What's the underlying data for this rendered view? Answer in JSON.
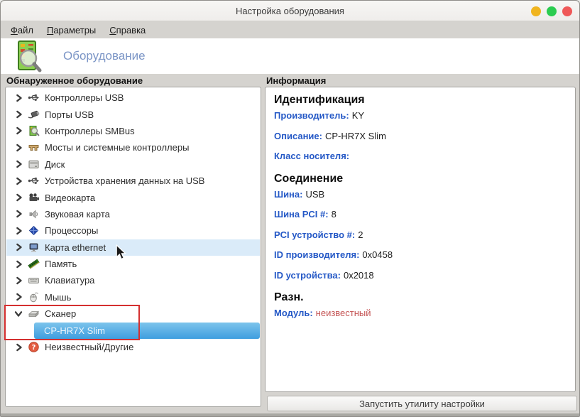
{
  "window": {
    "title": "Настройка оборудования"
  },
  "titlebar_buttons": [
    {
      "name": "minimize-button",
      "color": "#f0b41e"
    },
    {
      "name": "maximize-button",
      "color": "#2bcc50"
    },
    {
      "name": "close-button",
      "color": "#ef5858"
    }
  ],
  "menu": {
    "items": [
      {
        "label": "Файл"
      },
      {
        "label": "Параметры"
      },
      {
        "label": "Справка"
      }
    ]
  },
  "toolbar": {
    "title": "Оборудование",
    "icon": "hardware-magnifier-icon"
  },
  "left_panel": {
    "header": "Обнаруженное оборудование",
    "tree": [
      {
        "label": "Контроллеры USB",
        "icon": "usb-icon"
      },
      {
        "label": "Порты USB",
        "icon": "usb-port-icon"
      },
      {
        "label": "Контроллеры SMBus",
        "icon": "circuit-board-icon"
      },
      {
        "label": "Мосты и системные контроллеры",
        "icon": "bridge-icon"
      },
      {
        "label": "Диск",
        "icon": "disk-icon"
      },
      {
        "label": "Устройства хранения данных на USB",
        "icon": "usb-icon"
      },
      {
        "label": "Видеокарта",
        "icon": "video-card-icon"
      },
      {
        "label": "Звуковая карта",
        "icon": "sound-card-icon"
      },
      {
        "label": "Процессоры",
        "icon": "cpu-icon"
      },
      {
        "label": "Карта ethernet",
        "icon": "ethernet-icon",
        "state": "hover"
      },
      {
        "label": "Память",
        "icon": "memory-icon"
      },
      {
        "label": "Клавиатура",
        "icon": "keyboard-icon"
      },
      {
        "label": "Мышь",
        "icon": "mouse-icon"
      },
      {
        "label": "Сканер",
        "icon": "scanner-icon",
        "expanded": true
      },
      {
        "label": "CP-HR7X Slim",
        "child": true,
        "state": "selected"
      },
      {
        "label": "Неизвестный/Другие",
        "icon": "unknown-icon"
      }
    ]
  },
  "right_panel": {
    "header": "Информация",
    "sections": [
      {
        "title": "Идентификация",
        "fields": [
          {
            "label": "Производитель:",
            "value": "KY"
          },
          {
            "label": "Описание:",
            "value": "CP-HR7X Slim"
          },
          {
            "label": "Класс носителя:",
            "value": ""
          }
        ]
      },
      {
        "title": "Соединение",
        "fields": [
          {
            "label": "Шина:",
            "value": "USB"
          },
          {
            "label": "Шина PCI #:",
            "value": "8"
          },
          {
            "label": "PCI устройство #:",
            "value": "2"
          },
          {
            "label": "ID производителя:",
            "value": "0x0458"
          },
          {
            "label": "ID устройства:",
            "value": "0x2018"
          }
        ]
      },
      {
        "title": "Разн.",
        "fields": [
          {
            "label": "Модуль:",
            "value": "неизвестный",
            "value_color": "#c45353"
          }
        ]
      }
    ],
    "action_button": "Запустить утилиту настройки"
  },
  "annotation": {
    "rect_color": "#d43030"
  },
  "colors": {
    "selection_blue": "#4aa8e4",
    "hover_blue": "#daebf9",
    "label_blue": "#2458c6",
    "danger_red": "#c45353"
  }
}
